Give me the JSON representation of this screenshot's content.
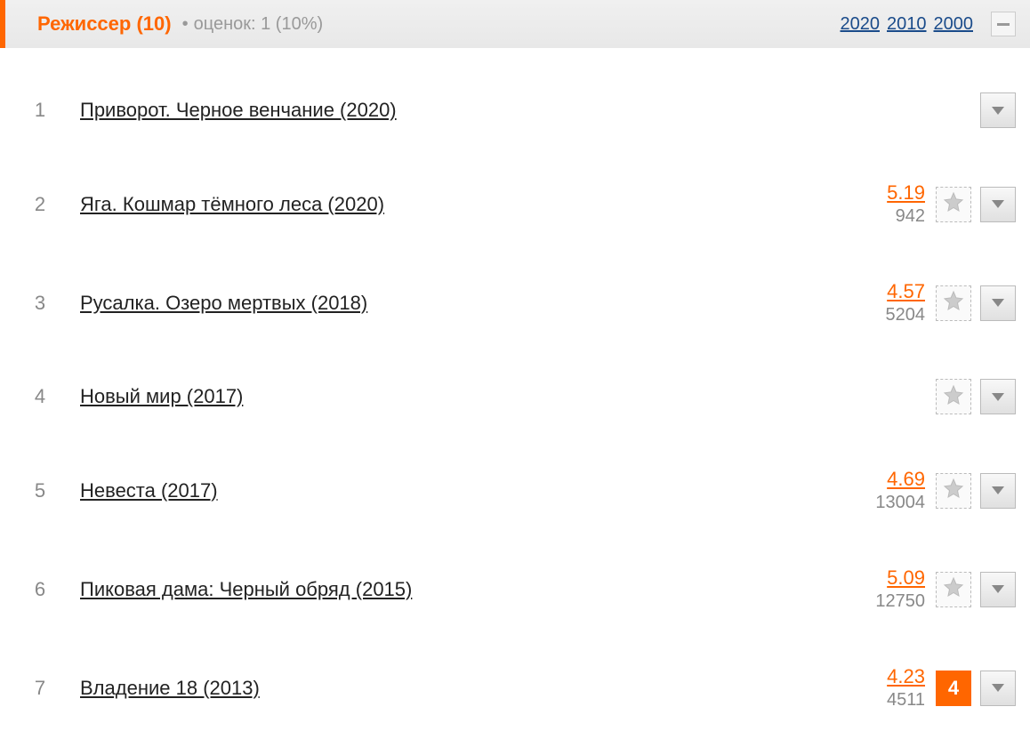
{
  "header": {
    "title": "Режиссер (10)",
    "subtitle": "оценок: 1 (10%)",
    "years": [
      "2020",
      "2010",
      "2000"
    ]
  },
  "movies": [
    {
      "num": "1",
      "title": "Приворот. Черное венчание (2020)",
      "rating": null,
      "votes": null,
      "has_star": false,
      "user_rating": null
    },
    {
      "num": "2",
      "title": "Яга. Кошмар тёмного леса (2020)",
      "rating": "5.19",
      "votes": "942",
      "has_star": true,
      "user_rating": null
    },
    {
      "num": "3",
      "title": "Русалка. Озеро мертвых (2018)",
      "rating": "4.57",
      "votes": "5204",
      "has_star": true,
      "user_rating": null
    },
    {
      "num": "4",
      "title": "Новый мир (2017)",
      "rating": null,
      "votes": null,
      "has_star": true,
      "user_rating": null
    },
    {
      "num": "5",
      "title": "Невеста (2017)",
      "rating": "4.69",
      "votes": "13004",
      "has_star": true,
      "user_rating": null
    },
    {
      "num": "6",
      "title": "Пиковая дама: Черный обряд (2015)",
      "rating": "5.09",
      "votes": "12750",
      "has_star": true,
      "user_rating": null
    },
    {
      "num": "7",
      "title": "Владение 18 (2013)",
      "rating": "4.23",
      "votes": "4511",
      "has_star": false,
      "user_rating": "4"
    }
  ]
}
